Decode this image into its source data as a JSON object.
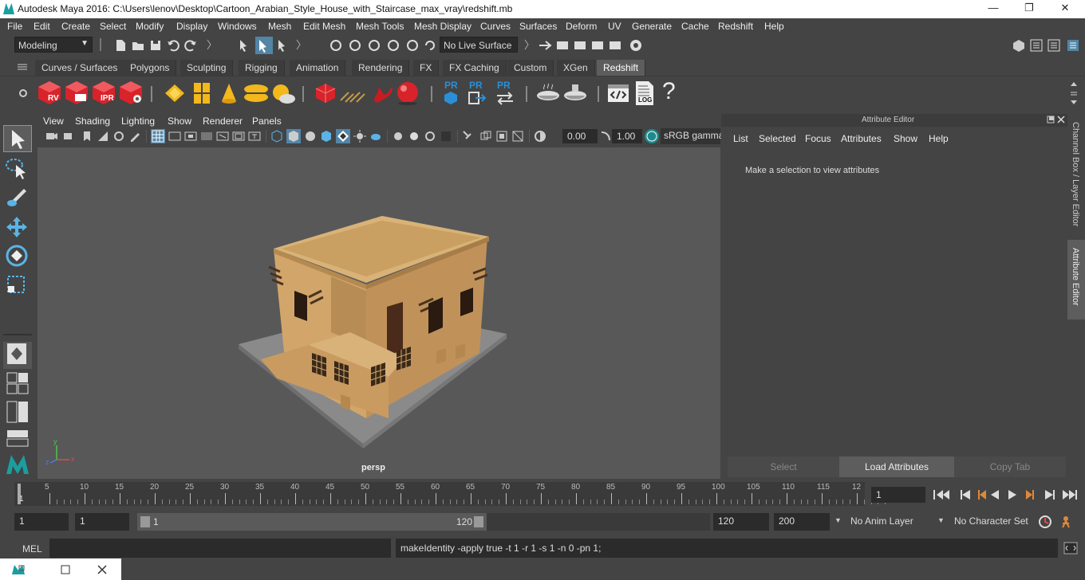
{
  "window": {
    "title": "Autodesk Maya 2016: C:\\Users\\lenov\\Desktop\\Cartoon_Arabian_Style_House_with_Staircase_max_vray\\redshift.mb",
    "minimize": "—",
    "maximize": "❐",
    "close": "✕"
  },
  "menubar": [
    "File",
    "Edit",
    "Create",
    "Select",
    "Modify",
    "Display",
    "Windows",
    "Mesh",
    "Edit Mesh",
    "Mesh Tools",
    "Mesh Display",
    "Curves",
    "Surfaces",
    "Deform",
    "UV",
    "Generate",
    "Cache",
    "Redshift",
    "Help"
  ],
  "statusline": {
    "mode": "Modeling",
    "live_surface": "No Live Surface"
  },
  "shelf_tabs": [
    "Curves / Surfaces",
    "Polygons",
    "Sculpting",
    "Rigging",
    "Animation",
    "Rendering",
    "FX",
    "FX Caching",
    "Custom",
    "XGen",
    "Redshift"
  ],
  "active_shelf_tab": "Redshift",
  "shelf_labels": {
    "rv": "RV",
    "ipr": "IPR",
    "pr1": "PR",
    "pr2": "PR",
    "pr3": "PR",
    "log": "LOG",
    "help": "?"
  },
  "viewport": {
    "menu": [
      "View",
      "Shading",
      "Lighting",
      "Show",
      "Renderer",
      "Panels"
    ],
    "exposure": "0.00",
    "gamma": "1.00",
    "colorspace": "sRGB gamma",
    "camera_label": "persp",
    "axis_x": "x",
    "axis_y": "y",
    "axis_z": "z"
  },
  "attribute_editor": {
    "title": "Attribute Editor",
    "menu": [
      "List",
      "Selected",
      "Focus",
      "Attributes",
      "Show",
      "Help"
    ],
    "message": "Make a selection to view attributes",
    "buttons": {
      "select": "Select",
      "load": "Load Attributes",
      "copy": "Copy Tab"
    }
  },
  "side_tabs": {
    "channel_box": "Channel Box / Layer Editor",
    "attribute_editor": "Attribute Editor"
  },
  "timeline": {
    "ticks": [
      "5",
      "10",
      "15",
      "20",
      "25",
      "30",
      "35",
      "40",
      "45",
      "50",
      "55",
      "60",
      "65",
      "70",
      "75",
      "80",
      "85",
      "90",
      "95",
      "100",
      "105",
      "110",
      "115",
      "12"
    ],
    "current_label": "1",
    "current_frame": "1"
  },
  "range": {
    "start": "1",
    "playback_start": "1",
    "slider_start": "1",
    "slider_end": "120",
    "playback_end": "120",
    "end": "200",
    "anim_layer": "No Anim Layer",
    "character_set": "No Character Set"
  },
  "cmdline": {
    "label": "MEL",
    "input": "",
    "result": "makeIdentity -apply true -t 1 -r 1 -s 1 -n 0 -pn 1;"
  },
  "colors": {
    "accent": "#5d5d5d",
    "panel": "#444444",
    "viewport": "#585858",
    "redshift_red": "#d8232a",
    "pr_blue": "#2a8fd6",
    "house": "#d2a66a"
  }
}
